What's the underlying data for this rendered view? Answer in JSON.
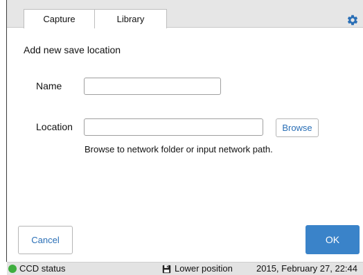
{
  "tabs": {
    "capture_label": "Capture",
    "library_label": "Library"
  },
  "header": {
    "gear_icon": "gear-icon",
    "accent_color": "#2a6fb6"
  },
  "form": {
    "heading": "Add new save location",
    "name_label": "Name",
    "name_value": "",
    "location_label": "Location",
    "location_value": "",
    "browse_label": "Browse",
    "hint": "Browse to network folder or input network path."
  },
  "actions": {
    "cancel_label": "Cancel",
    "ok_label": "OK",
    "ok_color": "#3a83c9"
  },
  "status": {
    "ccd_label": "CCD status",
    "ccd_color": "#3fae3f",
    "position_label": "Lower position",
    "position_icon": "save-icon",
    "timestamp": "2015, February 27, 22:44"
  }
}
